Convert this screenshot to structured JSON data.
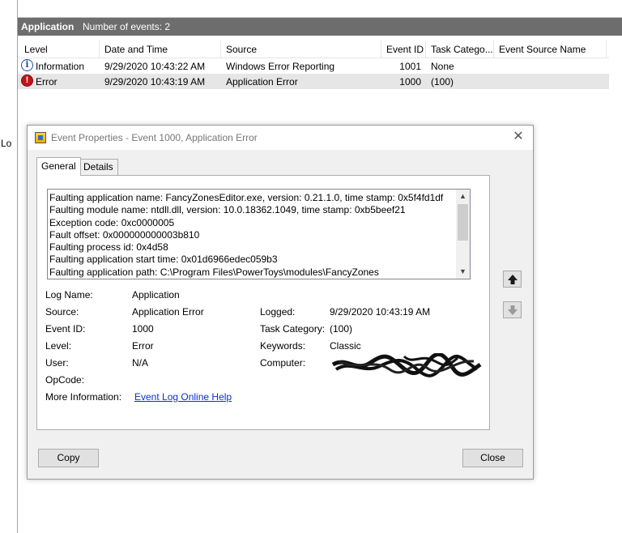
{
  "left_panel": {
    "truncated_text": "Lo"
  },
  "event_list": {
    "title": "Application",
    "count_text": "Number of events: 2",
    "columns": [
      "Level",
      "Date and Time",
      "Source",
      "Event ID",
      "Task Catego...",
      "Event Source Name"
    ],
    "rows": [
      {
        "level_icon": "information-icon",
        "level": "Information",
        "date": "9/29/2020 10:43:22 AM",
        "source": "Windows Error Reporting",
        "event_id": "1001",
        "task": "None",
        "source_name": ""
      },
      {
        "level_icon": "error-icon",
        "level": "Error",
        "date": "9/29/2020 10:43:19 AM",
        "source": "Application Error",
        "event_id": "1000",
        "task": "(100)",
        "source_name": ""
      }
    ],
    "selected_row": 1
  },
  "dialog": {
    "title": "Event Properties - Event 1000, Application Error",
    "tabs": [
      "General",
      "Details"
    ],
    "active_tab": "General",
    "description_lines": [
      "Faulting application name: FancyZonesEditor.exe, version: 0.21.1.0, time stamp: 0x5f4fd1df",
      "Faulting module name: ntdll.dll, version: 10.0.18362.1049, time stamp: 0xb5beef21",
      "Exception code: 0xc0000005",
      "Fault offset: 0x000000000003b810",
      "Faulting process id: 0x4d58",
      "Faulting application start time: 0x01d6966edec059b3",
      "Faulting application path: C:\\Program Files\\PowerToys\\modules\\FancyZones"
    ],
    "properties": {
      "log_name_label": "Log Name:",
      "log_name": "Application",
      "source_label": "Source:",
      "source": "Application Error",
      "logged_label": "Logged:",
      "logged": "9/29/2020 10:43:19 AM",
      "event_id_label": "Event ID:",
      "event_id": "1000",
      "task_category_label": "Task Category:",
      "task_category": "(100)",
      "level_label": "Level:",
      "level": "Error",
      "keywords_label": "Keywords:",
      "keywords": "Classic",
      "user_label": "User:",
      "user": "N/A",
      "computer_label": "Computer:",
      "opcode_label": "OpCode:",
      "more_info_label": "More Information:",
      "more_info_link": "Event Log Online Help"
    },
    "buttons": {
      "copy": "Copy",
      "close": "Close"
    },
    "side_buttons": [
      "up-arrow-icon",
      "down-arrow-icon"
    ]
  }
}
